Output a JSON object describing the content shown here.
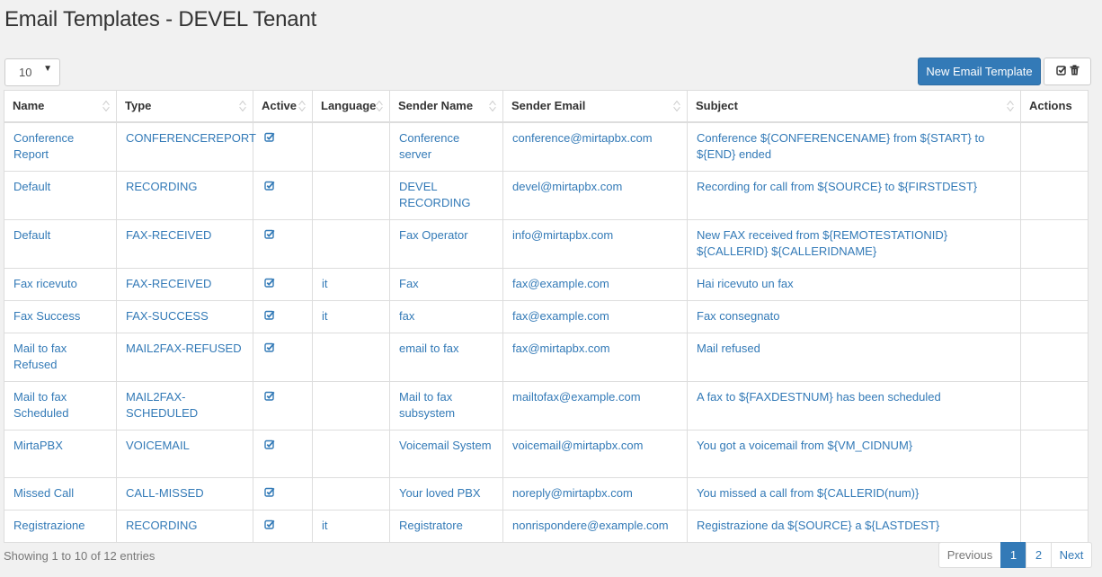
{
  "header": {
    "title": "Email Templates - DEVEL Tenant"
  },
  "toolbar": {
    "page_length": "10",
    "new_button_label": "New Email Template",
    "bulk_icons": [
      "check-square-icon",
      "trash-icon"
    ]
  },
  "table": {
    "columns": [
      "Name",
      "Type",
      "Active",
      "Language",
      "Sender Name",
      "Sender Email",
      "Subject",
      "Actions"
    ],
    "rows": [
      {
        "name": "Conference Report",
        "type": "CONFERENCEREPORT",
        "active": true,
        "language": "",
        "sender_name": "Conference server",
        "sender_email": "conference@mirtapbx.com",
        "subject": "Conference ${CONFERENCENAME} from ${START} to ${END} ended"
      },
      {
        "name": "Default",
        "type": "RECORDING",
        "active": true,
        "language": "",
        "sender_name": "DEVEL RECORDING",
        "sender_email": "devel@mirtapbx.com",
        "subject": "Recording for call from ${SOURCE} to ${FIRSTDEST}"
      },
      {
        "name": "Default",
        "type": "FAX-RECEIVED",
        "active": true,
        "language": "",
        "sender_name": "Fax Operator",
        "sender_email": "info@mirtapbx.com",
        "subject": "New FAX received from ${REMOTESTATIONID} ${CALLERID} ${CALLERIDNAME}"
      },
      {
        "name": "Fax ricevuto",
        "type": "FAX-RECEIVED",
        "active": true,
        "language": "it",
        "sender_name": "Fax",
        "sender_email": "fax@example.com",
        "subject": "Hai ricevuto un fax"
      },
      {
        "name": "Fax Success",
        "type": "FAX-SUCCESS",
        "active": true,
        "language": "it",
        "sender_name": "fax",
        "sender_email": "fax@example.com",
        "subject": "Fax consegnato"
      },
      {
        "name": "Mail to fax Refused",
        "type": "MAIL2FAX-REFUSED",
        "active": true,
        "language": "",
        "sender_name": "email to fax",
        "sender_email": "fax@mirtapbx.com",
        "subject": "Mail refused"
      },
      {
        "name": "Mail to fax Scheduled",
        "type": "MAIL2FAX-SCHEDULED",
        "active": true,
        "language": "",
        "sender_name": "Mail to fax subsystem",
        "sender_email": "mailtofax@example.com",
        "subject": "A fax to ${FAXDESTNUM} has been scheduled"
      },
      {
        "name": "MirtaPBX",
        "type": "VOICEMAIL",
        "active": true,
        "language": "",
        "sender_name": "Voicemail System",
        "sender_email": "voicemail@mirtapbx.com",
        "subject": "You got a voicemail from ${VM_CIDNUM}"
      },
      {
        "name": "Missed Call",
        "type": "CALL-MISSED",
        "active": true,
        "language": "",
        "sender_name": "Your loved PBX",
        "sender_email": "noreply@mirtapbx.com",
        "subject": "You missed a call from ${CALLERID(num)}"
      },
      {
        "name": "Registrazione",
        "type": "RECORDING",
        "active": true,
        "language": "it",
        "sender_name": "Registratore",
        "sender_email": "nonrispondere@example.com",
        "subject": "Registrazione da ${SOURCE} a ${LASTDEST}"
      }
    ]
  },
  "footer": {
    "info": "Showing 1 to 10 of 12 entries",
    "pagination": {
      "previous": "Previous",
      "pages": [
        "1",
        "2"
      ],
      "current": "1",
      "next": "Next"
    }
  },
  "colors": {
    "link": "#337ab7",
    "primary": "#337ab7",
    "background": "#f1f1f1"
  }
}
